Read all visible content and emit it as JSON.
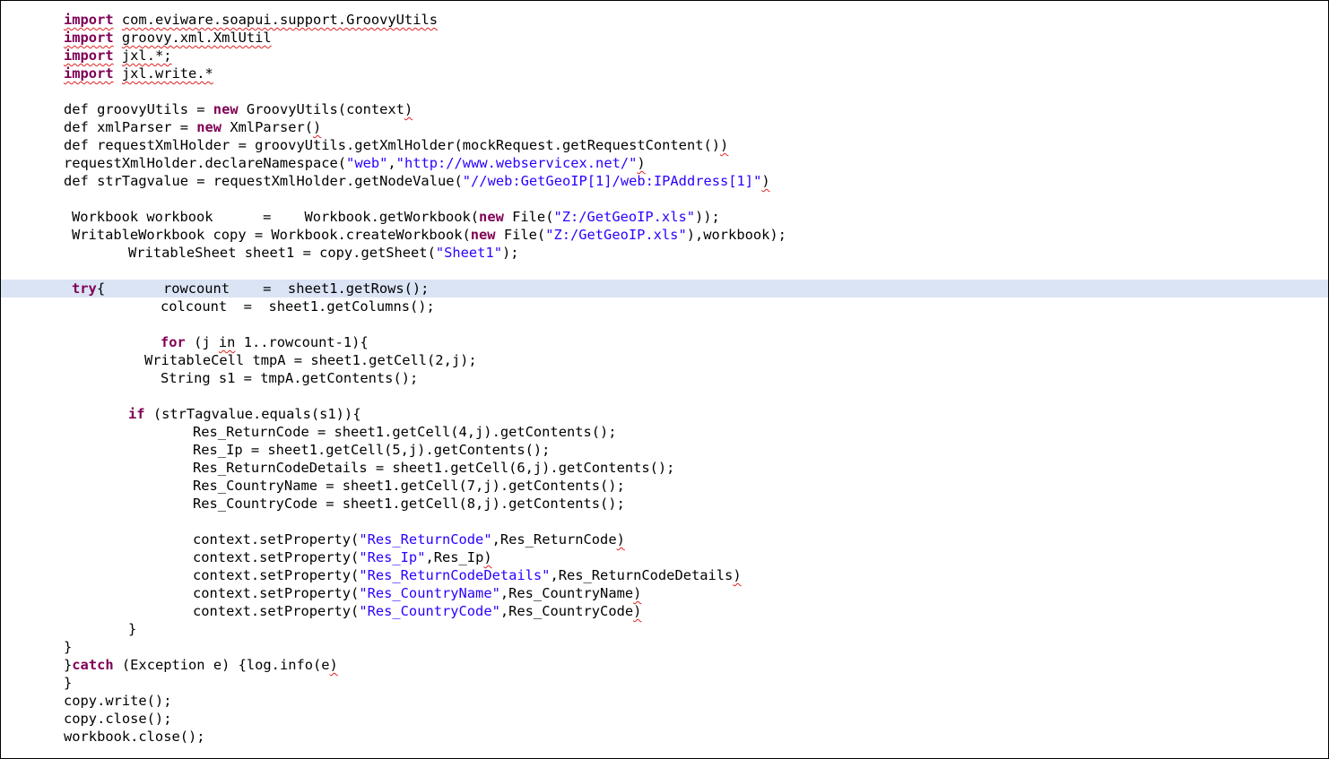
{
  "window": {
    "app": "Groovy script editor",
    "highlight_line": 16,
    "colors": {
      "keyword": "#7f0055",
      "string": "#2a00ff",
      "text": "#000000",
      "current_line": "#dbe4f5",
      "error_squiggle": "#e02020"
    }
  },
  "lines": [
    {
      "indent": 70,
      "tokens": [
        {
          "t": "import",
          "c": "kw squig"
        },
        {
          "t": " "
        },
        {
          "t": "com.eviware.soapui.support.GroovyUtils",
          "c": "squig"
        }
      ]
    },
    {
      "indent": 70,
      "tokens": [
        {
          "t": "import",
          "c": "kw squig"
        },
        {
          "t": " "
        },
        {
          "t": "groovy.xml.XmlUtil",
          "c": "squig"
        }
      ]
    },
    {
      "indent": 70,
      "tokens": [
        {
          "t": "import",
          "c": "kw squig"
        },
        {
          "t": " "
        },
        {
          "t": "jxl.*;",
          "c": "squig"
        }
      ]
    },
    {
      "indent": 70,
      "tokens": [
        {
          "t": "import",
          "c": "kw squig"
        },
        {
          "t": " "
        },
        {
          "t": "jxl.write.*",
          "c": "squig"
        }
      ]
    },
    {
      "indent": 0,
      "tokens": []
    },
    {
      "indent": 70,
      "tokens": [
        {
          "t": "def groovyUtils = "
        },
        {
          "t": "new",
          "c": "kw"
        },
        {
          "t": " GroovyUtils(context"
        },
        {
          "t": ")",
          "c": "squig"
        }
      ]
    },
    {
      "indent": 70,
      "tokens": [
        {
          "t": "def xmlParser = "
        },
        {
          "t": "new",
          "c": "kw"
        },
        {
          "t": " XmlParser("
        },
        {
          "t": ")",
          "c": "squig"
        }
      ]
    },
    {
      "indent": 70,
      "tokens": [
        {
          "t": "def requestXmlHolder = groovyUtils.getXmlHolder(mockRequest.getRequestContent()"
        },
        {
          "t": ")",
          "c": "squig"
        }
      ]
    },
    {
      "indent": 70,
      "tokens": [
        {
          "t": "requestXmlHolder.declareNamespace("
        },
        {
          "t": "\"web\"",
          "c": "str"
        },
        {
          "t": ","
        },
        {
          "t": "\"http://www.webservicex.net/\"",
          "c": "str"
        },
        {
          "t": ")",
          "c": "squig"
        }
      ]
    },
    {
      "indent": 70,
      "tokens": [
        {
          "t": "def strTagvalue = requestXmlHolder.getNodeValue("
        },
        {
          "t": "\"//web:GetGeoIP[1]/web:IPAddress[1]\"",
          "c": "str"
        },
        {
          "t": ")",
          "c": "squig"
        }
      ]
    },
    {
      "indent": 0,
      "tokens": []
    },
    {
      "indent": 79,
      "tokens": [
        {
          "t": "Workbook workbook      =    Workbook.getWorkbook("
        },
        {
          "t": "new",
          "c": "kw"
        },
        {
          "t": " File("
        },
        {
          "t": "\"Z:/GetGeoIP.xls\"",
          "c": "str"
        },
        {
          "t": "));"
        }
      ]
    },
    {
      "indent": 79,
      "tokens": [
        {
          "t": "WritableWorkbook copy = Workbook.createWorkbook("
        },
        {
          "t": "new",
          "c": "kw"
        },
        {
          "t": " File("
        },
        {
          "t": "\"Z:/GetGeoIP.xls\"",
          "c": "str"
        },
        {
          "t": "),workbook);"
        }
      ]
    },
    {
      "indent": 142,
      "tokens": [
        {
          "t": "WritableSheet sheet1 = copy.getSheet("
        },
        {
          "t": "\"Sheet1\"",
          "c": "str"
        },
        {
          "t": ");"
        }
      ]
    },
    {
      "indent": 0,
      "tokens": []
    },
    {
      "indent": 79,
      "tokens": [
        {
          "t": "try",
          "c": "kw"
        },
        {
          "t": "{       rowcount    =  sheet1.getRows();"
        }
      ]
    },
    {
      "indent": 178,
      "tokens": [
        {
          "t": "colcount  =  sheet1.getColumns();"
        }
      ]
    },
    {
      "indent": 0,
      "tokens": []
    },
    {
      "indent": 178,
      "tokens": [
        {
          "t": "for",
          "c": "kw"
        },
        {
          "t": " (j "
        },
        {
          "t": "in",
          "c": "squig"
        },
        {
          "t": " 1..rowcount-1){"
        }
      ]
    },
    {
      "indent": 160,
      "tokens": [
        {
          "t": "WritableCell tmpA = sheet1.getCell(2,j);"
        }
      ]
    },
    {
      "indent": 178,
      "tokens": [
        {
          "t": "String s1 = tmpA.getContents();"
        }
      ]
    },
    {
      "indent": 0,
      "tokens": []
    },
    {
      "indent": 142,
      "tokens": [
        {
          "t": "if",
          "c": "kw"
        },
        {
          "t": " (strTagvalue.equals(s1)){"
        }
      ]
    },
    {
      "indent": 214,
      "tokens": [
        {
          "t": "Res_ReturnCode = sheet1.getCell(4,j).getContents();"
        }
      ]
    },
    {
      "indent": 214,
      "tokens": [
        {
          "t": "Res_Ip = sheet1.getCell(5,j).getContents();"
        }
      ]
    },
    {
      "indent": 214,
      "tokens": [
        {
          "t": "Res_ReturnCodeDetails = sheet1.getCell(6,j).getContents();"
        }
      ]
    },
    {
      "indent": 214,
      "tokens": [
        {
          "t": "Res_CountryName = sheet1.getCell(7,j).getContents();"
        }
      ]
    },
    {
      "indent": 214,
      "tokens": [
        {
          "t": "Res_CountryCode = sheet1.getCell(8,j).getContents();"
        }
      ]
    },
    {
      "indent": 0,
      "tokens": []
    },
    {
      "indent": 214,
      "tokens": [
        {
          "t": "context.setProperty("
        },
        {
          "t": "\"Res_ReturnCode\"",
          "c": "str"
        },
        {
          "t": ",Res_ReturnCode"
        },
        {
          "t": ")",
          "c": "squig"
        }
      ]
    },
    {
      "indent": 214,
      "tokens": [
        {
          "t": "context.setProperty("
        },
        {
          "t": "\"Res_Ip\"",
          "c": "str"
        },
        {
          "t": ",Res_Ip"
        },
        {
          "t": ")",
          "c": "squig"
        }
      ]
    },
    {
      "indent": 214,
      "tokens": [
        {
          "t": "context.setProperty("
        },
        {
          "t": "\"Res_ReturnCodeDetails\"",
          "c": "str"
        },
        {
          "t": ",Res_ReturnCodeDetails"
        },
        {
          "t": ")",
          "c": "squig"
        }
      ]
    },
    {
      "indent": 214,
      "tokens": [
        {
          "t": "context.setProperty("
        },
        {
          "t": "\"Res_CountryName\"",
          "c": "str"
        },
        {
          "t": ",Res_CountryName"
        },
        {
          "t": ")",
          "c": "squig"
        }
      ]
    },
    {
      "indent": 214,
      "tokens": [
        {
          "t": "context.setProperty("
        },
        {
          "t": "\"Res_CountryCode\"",
          "c": "str"
        },
        {
          "t": ",Res_CountryCode"
        },
        {
          "t": ")",
          "c": "squig"
        }
      ]
    },
    {
      "indent": 142,
      "tokens": [
        {
          "t": "}"
        }
      ]
    },
    {
      "indent": 70,
      "tokens": [
        {
          "t": "}"
        }
      ]
    },
    {
      "indent": 70,
      "tokens": [
        {
          "t": "}"
        },
        {
          "t": "catch",
          "c": "kw"
        },
        {
          "t": " (Exception e) {log.info(e"
        },
        {
          "t": ")",
          "c": "squig"
        }
      ]
    },
    {
      "indent": 70,
      "tokens": [
        {
          "t": "}"
        }
      ]
    },
    {
      "indent": 70,
      "tokens": [
        {
          "t": "copy.write();"
        }
      ]
    },
    {
      "indent": 70,
      "tokens": [
        {
          "t": "copy.close();"
        }
      ]
    },
    {
      "indent": 70,
      "tokens": [
        {
          "t": "workbook.close();"
        }
      ]
    }
  ]
}
